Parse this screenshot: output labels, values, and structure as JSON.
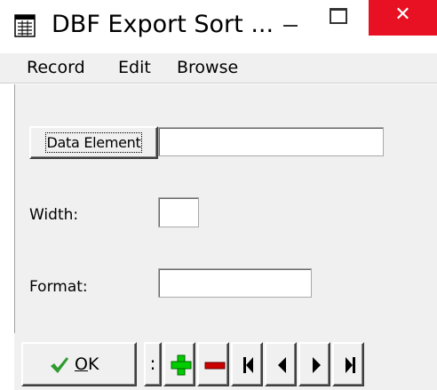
{
  "window": {
    "title": "DBF Export Sort ...",
    "close_glyph": "✕"
  },
  "menu": {
    "items": [
      "Record",
      "Edit",
      "Browse"
    ]
  },
  "form": {
    "data_element_button": "Data Element",
    "data_element_value": "",
    "width_label": "Width:",
    "width_value": "",
    "format_label": "Format:",
    "format_value": ""
  },
  "toolbar": {
    "ok_label_underlined": "O",
    "ok_label_rest": "K",
    "separator_glyph": ":",
    "icons": [
      "add-record-icon",
      "delete-record-icon",
      "first-record-icon",
      "previous-record-icon",
      "next-record-icon",
      "last-record-icon"
    ],
    "colors": {
      "add": "#00cc00",
      "delete": "#cc0000",
      "check": "#2f9a2f"
    }
  }
}
